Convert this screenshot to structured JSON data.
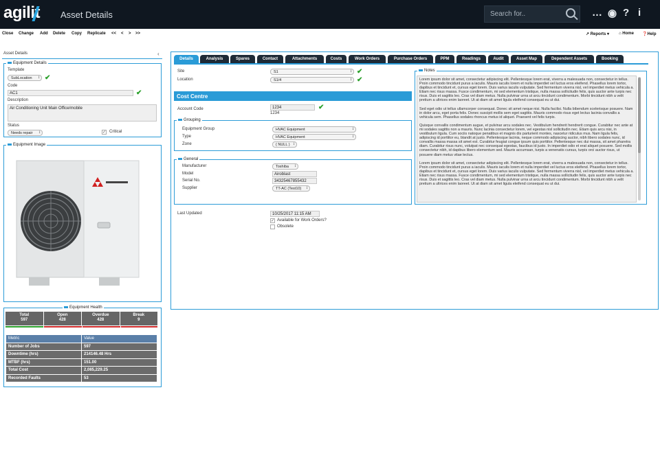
{
  "header": {
    "logo": "agilit",
    "title": "Asset Details",
    "search_placeholder": "Search for.."
  },
  "toolbar": {
    "items": [
      "Close",
      "Change",
      "Add",
      "Delete",
      "Copy",
      "Replicate",
      "<<",
      "<",
      ">",
      ">>"
    ],
    "reports": "Reports",
    "home": "Home",
    "help": "Help"
  },
  "left_panel": {
    "title": "Asset Details",
    "equipment_details": {
      "legend": "Equipment Details",
      "template_label": "Template",
      "template_value": "SubLocation",
      "code_label": "Code",
      "code_value": "AC1",
      "description_label": "Description",
      "description_value": "Air Conditioning Unit Main Office/mobile",
      "status_label": "Status",
      "status_value": "Needs repair",
      "critical_label": "Critical"
    },
    "image_legend": "Equipment Image",
    "health": {
      "legend": "Equipment Health",
      "cells": [
        {
          "label": "Total",
          "value": "597"
        },
        {
          "label": "Open",
          "value": "428"
        },
        {
          "label": "Overdue",
          "value": "428"
        },
        {
          "label": "Break",
          "value": "9"
        }
      ],
      "bar_colors": [
        "#2aa02a",
        "#d02828",
        "#d02828",
        "#d02828"
      ],
      "metrics_header": [
        "Metric",
        "Value"
      ],
      "metrics": [
        [
          "Number of Jobs",
          "597"
        ],
        [
          "Downtime (hrs)",
          "214146.48 Hrs"
        ],
        [
          "MTBF (hrs)",
          "151.00"
        ],
        [
          "Total Cost",
          "2,085,229.25"
        ],
        [
          "Recorded Faults",
          "53"
        ]
      ]
    }
  },
  "tabs": [
    "Details",
    "Analysis",
    "Spares",
    "Contact",
    "Attachments",
    "Costs",
    "Work Orders",
    "Purchase Orders",
    "PPM",
    "Readings",
    "Audit",
    "Asset Map",
    "Dependent Assets",
    "Booking"
  ],
  "details": {
    "site_label": "Site",
    "site_value": "S1",
    "location_label": "Location",
    "location_value": "S1/4",
    "cost_centre_header": "Cost Centre",
    "account_code_label": "Account Code",
    "account_code_value": "1234",
    "account_code_sub": "1234",
    "grouping": {
      "legend": "Grouping",
      "equipment_group_label": "Equipment Group",
      "equipment_group_value": "HVAC Equipment",
      "type_label": "Type",
      "type_value": "HVAC Equipment",
      "zone_label": "Zone",
      "zone_value": "( NULL )"
    },
    "general": {
      "legend": "General",
      "manufacturer_label": "Manufacturer",
      "manufacturer_value": "Toshiba",
      "model_label": "Model",
      "model_value": "Airoblast",
      "serial_label": "Serial No.",
      "serial_value": "34325467855432",
      "supplier_label": "Supplier",
      "supplier_value": "TT-AC (Test10)"
    },
    "last_updated_label": "Last Updated",
    "last_updated_value": "10/25/2017 11:15 AM",
    "available_label": "Available for Work Orders?",
    "obsolete_label": "Obsolete"
  },
  "notes": {
    "legend": "Notes",
    "paragraphs": [
      "Lorem ipsum dolor sit amet, consectetur adipiscing elit. Pellentesque lorem erat, viverra a malesuada non, consectetur in tellus. Proin commodo tincidunt purus a iaculis. Mauris iaculis lorem et nulla imperdiet vel luctus eros eleifend. Phasellus lorem tortor, dapibus et tincidunt et, cursus eget lorem. Duis varius iaculis vulputate. Sed fermentum viverra nisl, vel imperdiet metus vehicula a. Etiam nec risus massa. Fusce condimentum, mi sed elementum tristique, nulla massa sollicitudin felis, quis auctor ante turpis nec risus. Duis et sagittis leo. Cras vel diam metus. Nulla pulvinar urna ut arcu tincidunt condimentum. Morbi tincidunt nibh a velit pretium a ultrices enim laoreet. Ut at diam sit amet ligula eleifend consequat eu ut dui.",
      "Sed eget odio ut tellus ullamcorper consequat. Donec sit amet neque nisi. Nulla facilisi. Nulla bibendum scelerisque posuere. Nam in dolor arcu, eget porta felis. Donec suscipit mollis sem eget sagittis. Mauris commodo risus eget lectus lacinia convallis a vehicula sem. Phasellus sodales rhoncus metus id aliquet. Praesent vel felis turpis.",
      "Quisque convallis condimentum augue, et pulvinar arcu sodales nec. Vestibulum hendrerit hendrerit congue. Curabitur nec ante at mi sodales sagittis non a mauris. Nunc lacinia consectetur lorem, vel egestas nisl sollicitudin nec. Etiam quis arcu nisi, in vestibulum ligula. Cum sociis natoque penatibus et magnis dis parturient montes, nascetur ridiculus mus. Nam ligula felis, adipiscing id porttitor eu, blandit at justo. Pellentesque lacinia, neque commodo adipiscing auctor, nibh libero sodales nunc, id convallis massa massa sit amet est. Curabitur feugiat congue ipsum quis porttitor. Pellentesque nec dui massa, sit amet pharetra diam. Curabitur risus nunc, volutpat nec consequat egestas, faucibus id justo. In imperdiet odio et erat aliquet posuere. Sed mollis consectetur nibh, id dapibus libero elementum sed. Mauris accumsan, turpis a venenatis cursus, turpis orci auctor risus, ut posuere diam metus vitae lectus.",
      "Lorem ipsum dolor sit amet, consectetur adipiscing elit. Pellentesque lorem erat, viverra a malesuada non, consectetur in tellus. Proin commodo tincidunt purus a iaculis. Mauris iaculis lorem et nulla imperdiet vel luctus eros eleifend. Phasellus lorem tortor, dapibus et tincidunt et, cursus eget lorem. Duis varius iaculis vulputate. Sed fermentum viverra nisl, vel imperdiet metus vehicula a. Etiam nec risus massa. Fusce condimentum, mi sed elementum tristique, nulla massa sollicitudin felis, quis auctor ante turpis nec risus. Duis et sagittis leo. Cras vel diam metus. Nulla pulvinar urna ut arcu tincidunt condimentum. Morbi tincidunt nibh a velit pretium a ultrices enim laoreet. Ut at diam sit amet ligula eleifend consequat eu ut dui."
    ]
  },
  "colors": {
    "accent": "#2a9bd7",
    "topbar": "#0f1720",
    "tab_bg": "#1e2a36",
    "ok_green": "#2aa02a"
  }
}
